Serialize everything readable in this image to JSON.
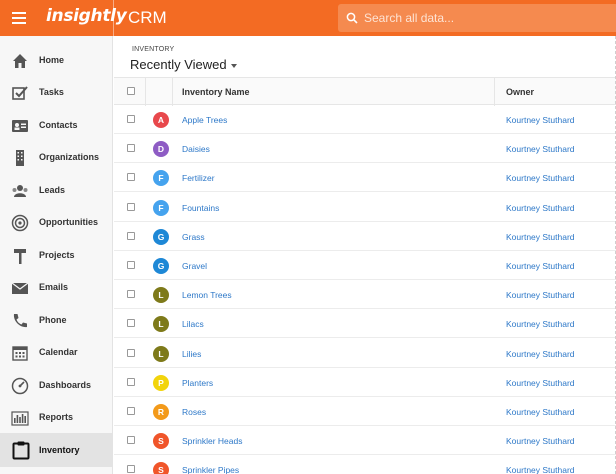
{
  "header": {
    "logo": "insightly",
    "app_name": "CRM",
    "search_placeholder": "Search all data...",
    "accent_color": "#f36b23"
  },
  "sidebar": {
    "items": [
      {
        "label": "Home",
        "icon": "home-icon"
      },
      {
        "label": "Tasks",
        "icon": "tasks-icon"
      },
      {
        "label": "Contacts",
        "icon": "contacts-icon"
      },
      {
        "label": "Organizations",
        "icon": "organizations-icon"
      },
      {
        "label": "Leads",
        "icon": "leads-icon"
      },
      {
        "label": "Opportunities",
        "icon": "opportunities-icon"
      },
      {
        "label": "Projects",
        "icon": "projects-icon"
      },
      {
        "label": "Emails",
        "icon": "emails-icon"
      },
      {
        "label": "Phone",
        "icon": "phone-icon"
      },
      {
        "label": "Calendar",
        "icon": "calendar-icon"
      },
      {
        "label": "Dashboards",
        "icon": "dashboards-icon"
      },
      {
        "label": "Reports",
        "icon": "reports-icon"
      },
      {
        "label": "Inventory",
        "icon": "inventory-icon",
        "active": true
      }
    ]
  },
  "main": {
    "section_label": "INVENTORY",
    "view_title": "Recently Viewed",
    "columns": [
      "Inventory Name",
      "Owner"
    ],
    "rows": [
      {
        "letter": "A",
        "color": "#e8484c",
        "name": "Apple Trees",
        "owner": "Kourtney Stuthard"
      },
      {
        "letter": "D",
        "color": "#8e5cc4",
        "name": "Daisies",
        "owner": "Kourtney Stuthard"
      },
      {
        "letter": "F",
        "color": "#45a3ee",
        "name": "Fertilizer",
        "owner": "Kourtney Stuthard"
      },
      {
        "letter": "F",
        "color": "#45a3ee",
        "name": "Fountains",
        "owner": "Kourtney Stuthard"
      },
      {
        "letter": "G",
        "color": "#1e88d6",
        "name": "Grass",
        "owner": "Kourtney Stuthard"
      },
      {
        "letter": "G",
        "color": "#1e88d6",
        "name": "Gravel",
        "owner": "Kourtney Stuthard"
      },
      {
        "letter": "L",
        "color": "#7e7a1a",
        "name": "Lemon Trees",
        "owner": "Kourtney Stuthard"
      },
      {
        "letter": "L",
        "color": "#7e7a1a",
        "name": "Lilacs",
        "owner": "Kourtney Stuthard"
      },
      {
        "letter": "L",
        "color": "#7e7a1a",
        "name": "Lilies",
        "owner": "Kourtney Stuthard"
      },
      {
        "letter": "P",
        "color": "#f2d40c",
        "name": "Planters",
        "owner": "Kourtney Stuthard"
      },
      {
        "letter": "R",
        "color": "#f39a1a",
        "name": "Roses",
        "owner": "Kourtney Stuthard"
      },
      {
        "letter": "S",
        "color": "#f0552a",
        "name": "Sprinkler Heads",
        "owner": "Kourtney Stuthard"
      },
      {
        "letter": "S",
        "color": "#f0552a",
        "name": "Sprinkler Pipes",
        "owner": "Kourtney Stuthard"
      }
    ]
  }
}
